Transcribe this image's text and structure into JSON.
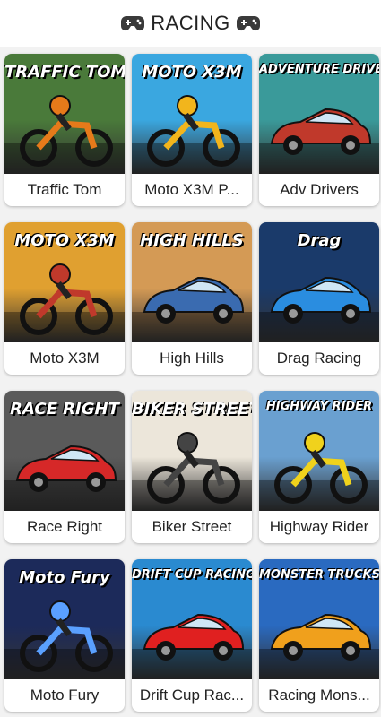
{
  "header": {
    "title": "RACING",
    "icon": "gamepad-icon"
  },
  "games": [
    {
      "title": "Traffic Tom",
      "logo": "TRAFFIC TOM",
      "bg": "#4a7a3a",
      "accent": "#e67a1a"
    },
    {
      "title": "Moto X3M P...",
      "logo": "MOTO X3M",
      "bg": "#3aa7e0",
      "accent": "#f2b51c"
    },
    {
      "title": "Adv Drivers",
      "logo": "ADVENTURE DRIVERS",
      "bg": "#3a9a9a",
      "accent": "#c0392b"
    },
    {
      "title": "Moto X3M",
      "logo": "MOTO X3M",
      "bg": "#e0a030",
      "accent": "#c0392b"
    },
    {
      "title": "High Hills",
      "logo": "HIGH HILLS",
      "bg": "#d49a55",
      "accent": "#3a6bb0"
    },
    {
      "title": "Drag Racing",
      "logo": "Drag",
      "bg": "#1a3a6a",
      "accent": "#2a8de0"
    },
    {
      "title": "Race Right",
      "logo": "RACE RIGHT",
      "bg": "#5a5a5a",
      "accent": "#d62828"
    },
    {
      "title": "Biker Street",
      "logo": "BIKER STREET",
      "bg": "#ece6da",
      "accent": "#444444"
    },
    {
      "title": "Highway Rider",
      "logo": "HIGHWAY RIDER",
      "bg": "#6aa0d0",
      "accent": "#f0d21c"
    },
    {
      "title": "Moto Fury",
      "logo": "Moto Fury",
      "bg": "#1c2a5a",
      "accent": "#5aa0ff"
    },
    {
      "title": "Drift Cup Rac...",
      "logo": "DRIFT CUP RACING",
      "bg": "#2a8ad0",
      "accent": "#e02020"
    },
    {
      "title": "Racing Mons...",
      "logo": "MONSTER TRUCKS",
      "bg": "#2a6ac0",
      "accent": "#f0a01c"
    }
  ]
}
